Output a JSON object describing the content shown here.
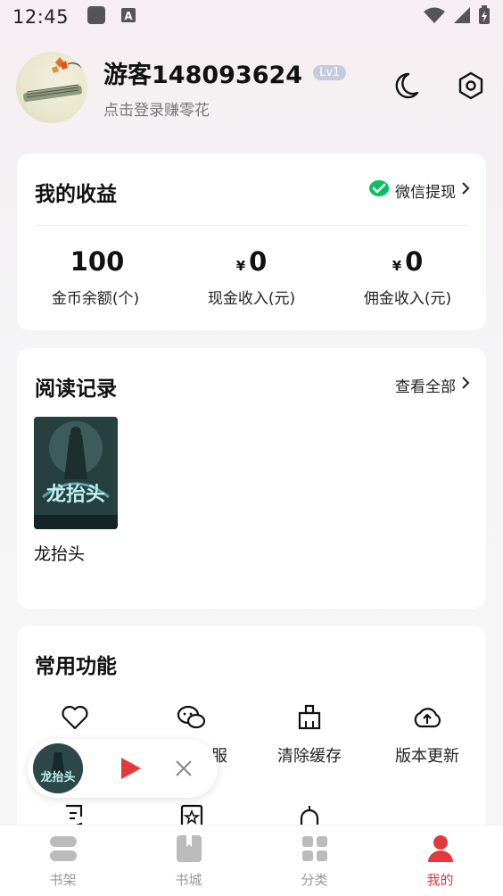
{
  "status_bar": {
    "time": "12:45"
  },
  "header": {
    "username": "游客148093624",
    "level": "Lv1",
    "subtitle": "点击登录赚零花",
    "icons": [
      "moon-icon",
      "settings-hexagon-icon"
    ]
  },
  "earnings": {
    "title": "我的收益",
    "link_label": "微信提现",
    "stats": [
      {
        "value": "100",
        "currency": "",
        "label": "金币余额(个)"
      },
      {
        "value": "0",
        "currency": "¥",
        "label": "现金收入(元)"
      },
      {
        "value": "0",
        "currency": "¥",
        "label": "佣金收入(元)"
      }
    ]
  },
  "reading": {
    "title": "阅读记录",
    "link_label": "查看全部",
    "books": [
      {
        "title": "龙抬头",
        "cover_text": "龙抬头"
      }
    ]
  },
  "functions": {
    "title": "常用功能",
    "items": [
      {
        "label": "",
        "icon": "heart-icon"
      },
      {
        "label": "服",
        "icon": "wechat-icon"
      },
      {
        "label": "清除缓存",
        "icon": "broom-icon"
      },
      {
        "label": "版本更新",
        "icon": "cloud-upload-icon"
      },
      {
        "label": "",
        "icon": "edit-note-icon"
      },
      {
        "label": "",
        "icon": "star-bookmark-icon"
      },
      {
        "label": "",
        "icon": "bell-icon"
      }
    ]
  },
  "mini_player": {
    "cover_text": "龙抬头"
  },
  "tabs": [
    {
      "label": "书架",
      "icon": "bookshelf-icon",
      "active": false
    },
    {
      "label": "书城",
      "icon": "bookstore-icon",
      "active": false
    },
    {
      "label": "分类",
      "icon": "category-grid-icon",
      "active": false
    },
    {
      "label": "我的",
      "icon": "profile-icon",
      "active": true
    }
  ],
  "colors": {
    "accent": "#e4393c",
    "wechat": "#07c160",
    "badge": "#c6c9e0"
  }
}
